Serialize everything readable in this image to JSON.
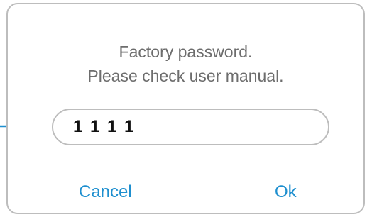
{
  "dialog": {
    "message_line1": "Factory password.",
    "message_line2": "Please check user manual.",
    "password_value": "1 1 1 1",
    "cancel_label": "Cancel",
    "ok_label": "Ok"
  },
  "colors": {
    "accent": "#1e8fcf",
    "border": "#bdbdbd",
    "message_text": "#6d6d6d"
  },
  "icons": {
    "pointer": "arrow-right-icon"
  }
}
